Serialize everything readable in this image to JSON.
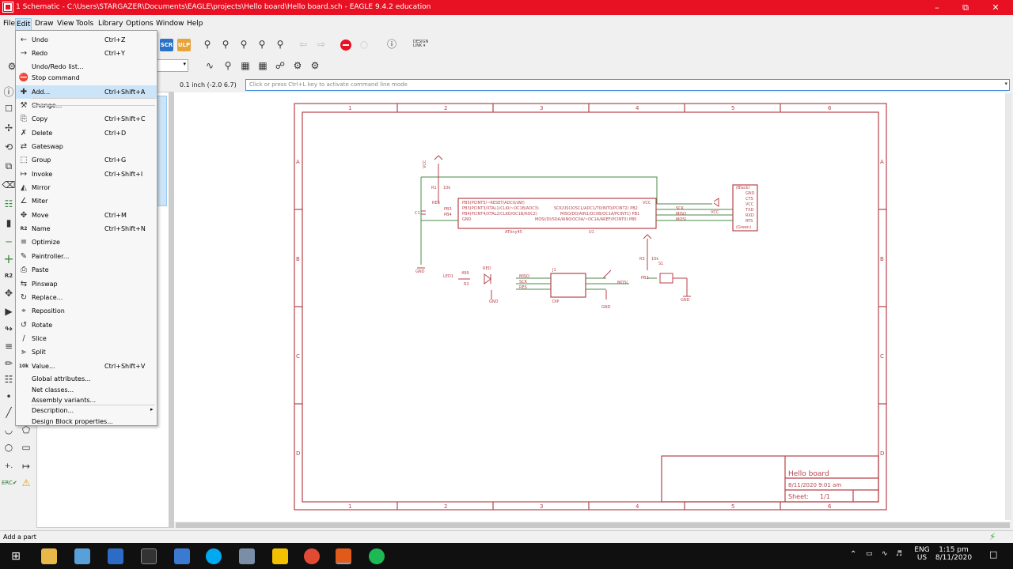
{
  "window": {
    "title": "1 Schematic - C:\\Users\\STARGAZER\\Documents\\EAGLE\\projects\\Hello board\\Hello board.sch - EAGLE 9.4.2 education",
    "controls": [
      "minimize",
      "maximize",
      "close"
    ]
  },
  "menubar": [
    "File",
    "Edit",
    "Draw",
    "View",
    "Tools",
    "Library",
    "Options",
    "Window",
    "Help"
  ],
  "toolbar": {
    "scr": "SCR",
    "ulp": "ULP",
    "design_link_line1": "DESIGN",
    "design_link_line2": "LINK ▾"
  },
  "coord_readout": "0.1 inch (-2.0 6.7)",
  "command_placeholder": "Click or press Ctrl+L key to activate command line mode",
  "edit_menu": [
    {
      "label": "Undo",
      "shortcut": "Ctrl+Z",
      "icon": "undo-icon"
    },
    {
      "label": "Redo",
      "shortcut": "Ctrl+Y",
      "icon": "redo-icon"
    },
    {
      "label": "Undo/Redo list...",
      "shortcut": "",
      "icon": ""
    },
    {
      "label": "Stop command",
      "shortcut": "",
      "icon": "stop-icon"
    },
    {
      "label": "Add...",
      "shortcut": "Ctrl+Shift+A",
      "icon": "add-icon"
    },
    {
      "label": "Change...",
      "shortcut": "",
      "icon": "wrench-icon"
    },
    {
      "label": "Copy",
      "shortcut": "Ctrl+Shift+C",
      "icon": "copy-icon"
    },
    {
      "label": "Delete",
      "shortcut": "Ctrl+D",
      "icon": "trash-icon"
    },
    {
      "label": "Gateswap",
      "shortcut": "",
      "icon": "gateswap-icon"
    },
    {
      "label": "Group",
      "shortcut": "Ctrl+G",
      "icon": "group-icon"
    },
    {
      "label": "Invoke",
      "shortcut": "Ctrl+Shift+I",
      "icon": "invoke-icon"
    },
    {
      "label": "Mirror",
      "shortcut": "",
      "icon": "mirror-icon"
    },
    {
      "label": "Miter",
      "shortcut": "",
      "icon": "miter-icon"
    },
    {
      "label": "Move",
      "shortcut": "Ctrl+M",
      "icon": "move-icon"
    },
    {
      "label": "Name",
      "shortcut": "Ctrl+Shift+N",
      "icon": "name-icon"
    },
    {
      "label": "Optimize",
      "shortcut": "",
      "icon": "optimize-icon"
    },
    {
      "label": "Paintroller...",
      "shortcut": "",
      "icon": "paintroller-icon"
    },
    {
      "label": "Paste",
      "shortcut": "",
      "icon": "paste-icon"
    },
    {
      "label": "Pinswap",
      "shortcut": "",
      "icon": "pinswap-icon"
    },
    {
      "label": "Replace...",
      "shortcut": "",
      "icon": "replace-icon"
    },
    {
      "label": "Reposition",
      "shortcut": "",
      "icon": "reposition-icon"
    },
    {
      "label": "Rotate",
      "shortcut": "",
      "icon": "rotate-icon"
    },
    {
      "label": "Slice",
      "shortcut": "",
      "icon": "slice-icon"
    },
    {
      "label": "Split",
      "shortcut": "",
      "icon": "split-icon"
    },
    {
      "label": "Value...",
      "shortcut": "Ctrl+Shift+V",
      "icon": "value-icon"
    },
    {
      "label": "Global attributes...",
      "shortcut": "",
      "icon": ""
    },
    {
      "label": "Net classes...",
      "shortcut": "",
      "icon": ""
    },
    {
      "label": "Assembly variants...",
      "shortcut": "",
      "icon": ""
    },
    {
      "label": "Description...",
      "shortcut": "",
      "icon": "",
      "submenu": true
    },
    {
      "label": "Design Block properties...",
      "shortcut": "",
      "icon": ""
    }
  ],
  "sheet": {
    "col_labels": [
      "1",
      "2",
      "3",
      "4",
      "5",
      "6"
    ],
    "row_labels": [
      "A",
      "B",
      "C",
      "D"
    ],
    "title_block": {
      "name": "Hello board",
      "date": "8/11/2020 9:01 am",
      "sheet_label": "Sheet:",
      "sheet_value": "1/1"
    }
  },
  "schematic_labels": {
    "vcc": "VCC",
    "gnd": "GND",
    "ic_name": "ATtiny45",
    "ic_ref": "U1",
    "ic_left_pins": [
      "PB5(PCINT5/~RESET/ADC0/dW)",
      "PB3(PCINT3/XTAL1/CLKI/~OC1B/ADC3)",
      "PB4(PCINT4/XTAL2/CLKO/OC1B/ADC2)",
      "GND"
    ],
    "ic_right_pins": [
      "VCC",
      "SCK/USCK/SCL/ADC1/T0/INT0/PCINT2) PB2",
      "MISO/DO/AIN1/OC0B/OC1A/PCINT1) PB1",
      "MOSI/DI/SDA/AIN0/OC0A/~OC1A/AREF/PCINT0) PB0"
    ],
    "rst": "RES",
    "pb3": "PB3",
    "pb4": "PB4",
    "sck": "SCK",
    "miso": "MISO",
    "mosi": "MOSI",
    "ftdi_pins": [
      "GND",
      "CTS",
      "VCC",
      "TXD",
      "RXD",
      "RTS"
    ],
    "ftdi_head": "(Black)",
    "ftdi_foot": "(Green)",
    "cap": "C1",
    "res1": "R1",
    "res1_val": "10k",
    "led": "LED1",
    "led_color": "RED",
    "res2": "R2",
    "res2_val": "499",
    "isp": "J1",
    "isp_foot": "DIP",
    "res3": "R3",
    "res3_val": "10k",
    "button": "S1",
    "pb2": "PB2"
  },
  "statusbar": {
    "message": "Add a part"
  },
  "taskbar": {
    "lang": "ENG",
    "locale": "US",
    "time": "1:15 pm",
    "date": "8/11/2020"
  },
  "colors": {
    "titlebar": "#e81123",
    "sheet_frame": "#b8424a",
    "wire": "#4a8a4a",
    "highlight": "#cce4f7"
  }
}
